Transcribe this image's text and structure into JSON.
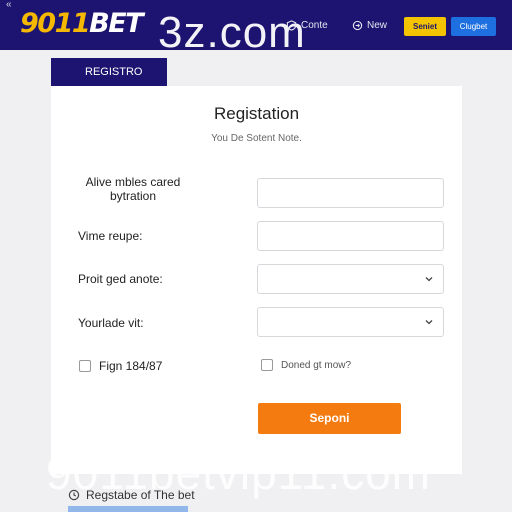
{
  "header": {
    "back_glyph": "«",
    "logo_digits": "9011",
    "logo_word": "BET",
    "watermark": "3z.com",
    "nav": [
      {
        "label": "Conte",
        "icon": "shield-icon"
      },
      {
        "label": "New",
        "icon": "circle-arrow-icon"
      }
    ],
    "signin_label": "Seniet",
    "register_label": "Clugbet"
  },
  "form": {
    "tab_label": "REGISTRO",
    "title": "Registation",
    "subtitle": "You De Sotent Note.",
    "fields": [
      {
        "label": "Alive mbles cared bytration",
        "type": "text",
        "value": ""
      },
      {
        "label": "Vime reupe:",
        "type": "text",
        "value": ""
      },
      {
        "label": "Proit ged anote:",
        "type": "select",
        "value": ""
      },
      {
        "label": "Yourlade vit:",
        "type": "select",
        "value": ""
      }
    ],
    "checkbox_left": "Fign 184/87",
    "checkbox_right": "Doned gt mow?",
    "submit_label": "Seponi"
  },
  "watermark_bottom": "9011betvip11.com",
  "footer": {
    "text": "Regstabe of The bet",
    "icon": "clock-icon"
  },
  "colors": {
    "nav_bg": "#1c1470",
    "logo_accent": "#f5b800",
    "signin_bg": "#f5c400",
    "register_bg": "#1e70e0",
    "submit_bg": "#f47b10"
  }
}
